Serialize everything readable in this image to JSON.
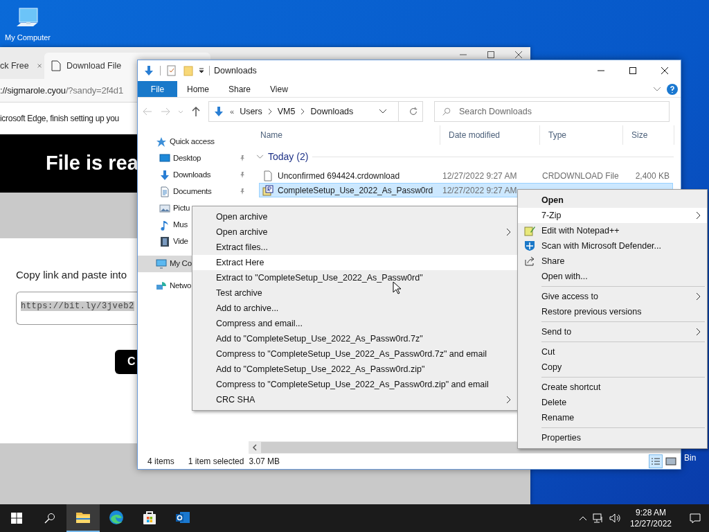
{
  "desktop": {
    "icons": [
      {
        "label": "My Computer",
        "kind": "computer"
      },
      {
        "label": "Bin",
        "kind": "bin"
      }
    ]
  },
  "browser": {
    "tabs": [
      {
        "label": "ck Free",
        "selected": false
      },
      {
        "label": "Download File",
        "selected": true
      }
    ],
    "address": {
      "host": "://sigmarole.cyou",
      "path": "/?sandy=2f4d1"
    },
    "infobar": "icrosoft Edge, finish setting up you",
    "banner": "File is rea",
    "prompt": "Copy link and paste into",
    "link_field": {
      "value": "https://bit.ly/3jveb2"
    },
    "button": "C"
  },
  "explorer": {
    "title": "Downloads",
    "ribbon_tabs": [
      {
        "label": "File",
        "selected": true
      },
      {
        "label": "Home",
        "selected": false
      },
      {
        "label": "Share",
        "selected": false
      },
      {
        "label": "View",
        "selected": false
      }
    ],
    "breadcrumb_overflow": "«",
    "breadcrumb": [
      "Users",
      "VM5",
      "Downloads"
    ],
    "search": {
      "placeholder": "Search Downloads"
    },
    "columns": [
      "Name",
      "Date modified",
      "Type",
      "Size"
    ],
    "group": "Today (2)",
    "rows": [
      {
        "kind": "document",
        "name": "Unconfirmed 694424.crdownload",
        "date": "12/27/2022 9:27 AM",
        "type": "CRDOWNLOAD File",
        "size": "2,400 KB",
        "selected": false
      },
      {
        "kind": "archive",
        "name": "CompleteSetup_Use_2022_As_Passw0rd",
        "date": "12/27/2022 9:27 AM",
        "selected": true
      }
    ],
    "sidebar": [
      {
        "kind": "star",
        "label": "Quick access",
        "pinned": false,
        "selected": false,
        "children": [
          {
            "kind": "desktop",
            "label": "Desktop",
            "pinned": true,
            "selected": false
          },
          {
            "kind": "download",
            "label": "Downloads",
            "pinned": true,
            "selected": false
          },
          {
            "kind": "document",
            "label": "Documents",
            "pinned": true,
            "selected": false
          },
          {
            "kind": "picture",
            "label": "Pictu",
            "selected": false
          },
          {
            "kind": "music",
            "label": "Mus",
            "selected": false
          },
          {
            "kind": "video",
            "label": "Vide",
            "selected": false
          }
        ]
      },
      {
        "kind": "computer",
        "label": "My Co",
        "selected": true
      },
      {
        "kind": "network",
        "label": "Netwo",
        "selected": false
      }
    ],
    "status": {
      "count": "4 items",
      "selection": "1 item selected",
      "size": "3.07 MB"
    }
  },
  "submenu": {
    "items": [
      {
        "label": "Open archive",
        "has_submenu": false,
        "selected": false
      },
      {
        "label": "Open archive",
        "has_submenu": true,
        "selected": false
      },
      {
        "label": "Extract files...",
        "has_submenu": false,
        "selected": false
      },
      {
        "label": "Extract Here",
        "has_submenu": false,
        "selected": true
      },
      {
        "label": "Extract to \"CompleteSetup_Use_2022_As_Passw0rd\"",
        "has_submenu": false,
        "selected": false
      },
      {
        "label": "Test archive",
        "has_submenu": false,
        "selected": false
      },
      {
        "label": "Add to archive...",
        "has_submenu": false,
        "selected": false
      },
      {
        "label": "Compress and email...",
        "has_submenu": false,
        "selected": false
      },
      {
        "label": "Add to \"CompleteSetup_Use_2022_As_Passw0rd.7z\"",
        "has_submenu": false,
        "selected": false
      },
      {
        "label": "Compress to \"CompleteSetup_Use_2022_As_Passw0rd.7z\" and email",
        "has_submenu": false,
        "selected": false
      },
      {
        "label": "Add to \"CompleteSetup_Use_2022_As_Passw0rd.zip\"",
        "has_submenu": false,
        "selected": false
      },
      {
        "label": "Compress to \"CompleteSetup_Use_2022_As_Passw0rd.zip\" and email",
        "has_submenu": false,
        "selected": false
      },
      {
        "label": "CRC SHA",
        "has_submenu": true,
        "selected": false
      }
    ]
  },
  "context_menu": {
    "items": [
      {
        "kind": "item",
        "label": "Open",
        "default": true,
        "has_submenu": false,
        "selected": false
      },
      {
        "kind": "item",
        "label": "7-Zip",
        "default": false,
        "has_submenu": true,
        "selected": true
      },
      {
        "kind": "notepad",
        "label": "Edit with Notepad++",
        "default": false,
        "has_submenu": false,
        "selected": false
      },
      {
        "kind": "shield",
        "label": "Scan with Microsoft Defender...",
        "default": false,
        "has_submenu": false,
        "selected": false
      },
      {
        "kind": "share",
        "label": "Share",
        "default": false,
        "has_submenu": false,
        "selected": false
      },
      {
        "kind": "item",
        "label": "Open with...",
        "default": false,
        "has_submenu": false,
        "selected": false
      },
      {
        "kind": "separator"
      },
      {
        "kind": "item",
        "label": "Give access to",
        "default": false,
        "has_submenu": true,
        "selected": false
      },
      {
        "kind": "item",
        "label": "Restore previous versions",
        "default": false,
        "has_submenu": false,
        "selected": false
      },
      {
        "kind": "separator"
      },
      {
        "kind": "item",
        "label": "Send to",
        "default": false,
        "has_submenu": true,
        "selected": false
      },
      {
        "kind": "separator"
      },
      {
        "kind": "item",
        "label": "Cut",
        "default": false,
        "has_submenu": false,
        "selected": false
      },
      {
        "kind": "item",
        "label": "Copy",
        "default": false,
        "has_submenu": false,
        "selected": false
      },
      {
        "kind": "separator"
      },
      {
        "kind": "item",
        "label": "Create shortcut",
        "default": false,
        "has_submenu": false,
        "selected": false
      },
      {
        "kind": "item",
        "label": "Delete",
        "default": false,
        "has_submenu": false,
        "selected": false
      },
      {
        "kind": "item",
        "label": "Rename",
        "default": false,
        "has_submenu": false,
        "selected": false
      },
      {
        "kind": "separator"
      },
      {
        "kind": "item",
        "label": "Properties",
        "default": false,
        "has_submenu": false,
        "selected": false
      }
    ]
  },
  "taskbar": {
    "apps": [
      {
        "kind": "explorer",
        "selected": true
      },
      {
        "kind": "edge",
        "selected": false
      },
      {
        "kind": "store",
        "selected": false
      },
      {
        "kind": "outlook",
        "selected": false
      }
    ],
    "clock": {
      "time": "9:28 AM",
      "date": "12/27/2022"
    }
  }
}
